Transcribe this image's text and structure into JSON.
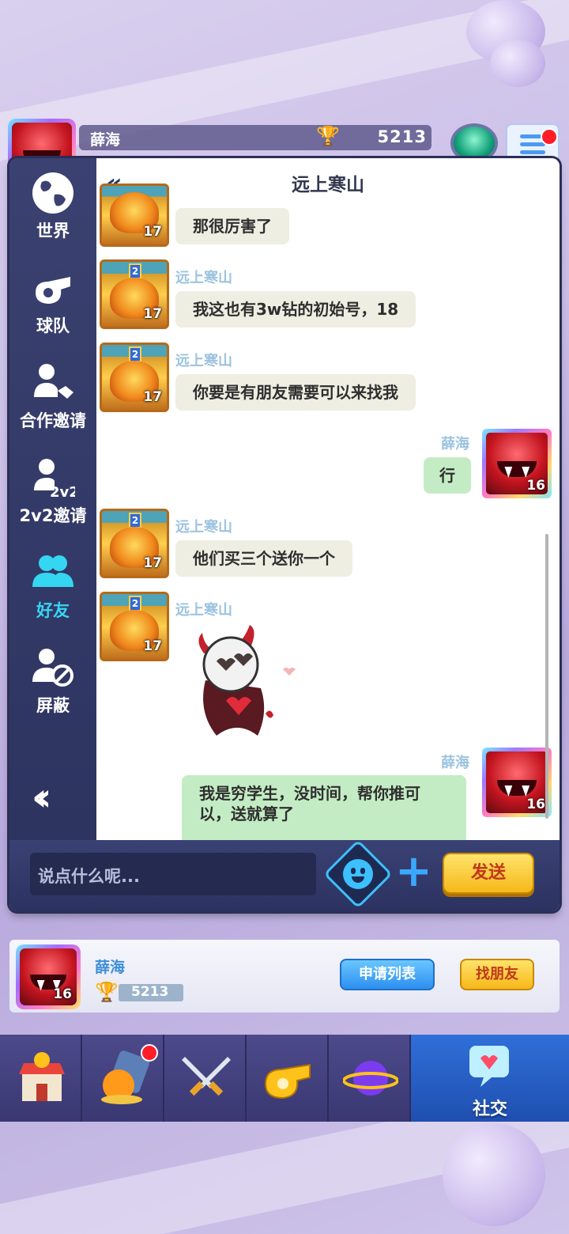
{
  "player": {
    "name": "薛海",
    "trophy_score": "5213",
    "level": "16"
  },
  "sidebar": {
    "items": [
      {
        "label": "世界",
        "icon": "globe-icon"
      },
      {
        "label": "球队",
        "icon": "whistle-icon"
      },
      {
        "label": "合作邀请",
        "icon": "handshake-user-icon"
      },
      {
        "label": "2v2邀请",
        "icon": "user-2v2-icon"
      },
      {
        "label": "好友",
        "icon": "friends-icon"
      },
      {
        "label": "屏蔽",
        "icon": "block-user-icon"
      }
    ],
    "active_index": 4,
    "collapse_icon": "double-chevron-left-icon"
  },
  "chat": {
    "title": "远上寒山",
    "back_icon": "double-chevron-left-icon",
    "messages": [
      {
        "from": "other",
        "sender": "",
        "text": "那很厉害了",
        "level": "17"
      },
      {
        "from": "other",
        "sender": "远上寒山",
        "text": "我这也有3w钻的初始号，18",
        "level": "17"
      },
      {
        "from": "other",
        "sender": "远上寒山",
        "text": "你要是有朋友需要可以来找我",
        "level": "17"
      },
      {
        "from": "me",
        "sender": "薛海",
        "text": "行",
        "level": "16"
      },
      {
        "from": "other",
        "sender": "远上寒山",
        "text": "他们买三个送你一个",
        "level": "17"
      },
      {
        "from": "other",
        "sender": "远上寒山",
        "sticker": "devil-skull-heart-sticker",
        "level": "17"
      },
      {
        "from": "me",
        "sender": "薛海",
        "text": "我是穷学生，没时间，帮你推可以，送就算了",
        "level": "16"
      }
    ],
    "input_placeholder": "说点什么呢...",
    "emoji_icon": "emoji-face-icon",
    "plus_icon": "plus-icon",
    "send_label": "发送"
  },
  "friend_card": {
    "name": "薛海",
    "score": "5213",
    "level": "16",
    "apply_list_label": "申请列表",
    "find_friend_label": "找朋友"
  },
  "bottom_nav": {
    "items": [
      {
        "icon": "shop-icon"
      },
      {
        "icon": "ball-cannon-icon",
        "badge": true
      },
      {
        "icon": "crossed-swords-icon"
      },
      {
        "icon": "whistle-icon"
      },
      {
        "icon": "planet-icon"
      },
      {
        "icon": "social-chat-icon",
        "label": "社交",
        "active": true
      }
    ]
  },
  "colors": {
    "accent_blue": "#35d6f2",
    "send_yellow": "#f6b81a",
    "incoming_bubble": "#efeee2",
    "outgoing_bubble": "#c4ecc4",
    "sender_name": "#9cc3df"
  }
}
